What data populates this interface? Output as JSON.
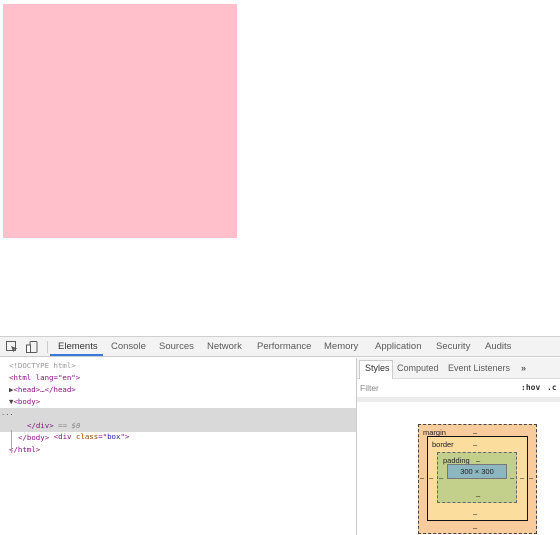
{
  "page": {
    "box_color": "#ffc0cb"
  },
  "devtools": {
    "toolbar": {
      "inspect_icon": "inspect-element-icon",
      "device_icon": "device-toolbar-icon",
      "tabs": [
        "Elements",
        "Console",
        "Sources",
        "Network",
        "Performance",
        "Memory",
        "Application",
        "Security",
        "Audits"
      ],
      "active_tab": "Elements"
    },
    "dom": {
      "doctype": "<!DOCTYPE html>",
      "html_open": "<html lang=\"en\">",
      "head": "<head>…</head>",
      "body_open": "<body>",
      "div_attr_name": "class",
      "div_attr_value": "box",
      "div_close": "</div>",
      "div_ref": "== $0",
      "body_close": "</body>",
      "html_close": "</html>",
      "gutter_dots": "..."
    },
    "sidebar": {
      "tabs": [
        "Styles",
        "Computed",
        "Event Listeners"
      ],
      "overflow": "»",
      "active_tab": "Styles",
      "filter_placeholder": "Filter",
      "hov": ":hov",
      "cls": ".c"
    },
    "box_model": {
      "margin_label": "margin",
      "border_label": "border",
      "padding_label": "padding",
      "dash": "–",
      "content": "300 × 300",
      "colors": {
        "margin": "#f9cc9d",
        "border": "#fbdd9d",
        "padding": "#c3d08b",
        "content": "#8cb6c0",
        "selection": "#d9d9d9",
        "active_tab": "#3879d9"
      }
    }
  }
}
